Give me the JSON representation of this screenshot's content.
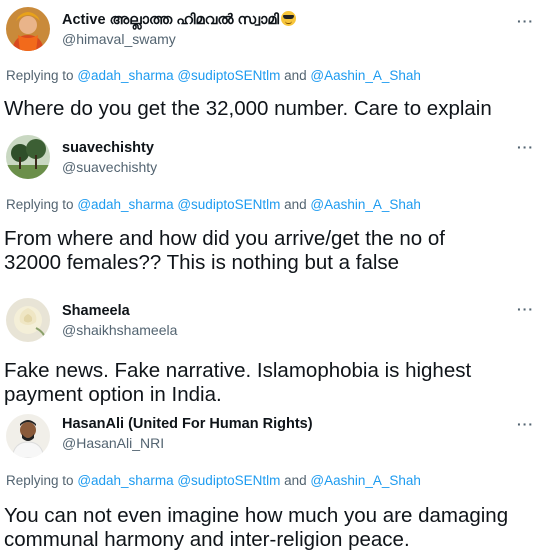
{
  "tweets": [
    {
      "name": "Active അല്ലാത്ത ഹിമവൽ സ്വാമി",
      "handle": "@himaval_swamy",
      "replying_prefix": "Replying to",
      "mentions": [
        "@adah_sharma",
        "@sudiptoSENtlm",
        "and",
        "@Aashin_A_Shah"
      ],
      "text": "Where do you get the 32,000 number. Care to explain",
      "more": "···",
      "emoji": "sunglasses-emoji"
    },
    {
      "name": "suavechishty",
      "handle": "@suavechishty",
      "replying_prefix": "Replying to",
      "mentions": [
        "@adah_sharma",
        "@sudiptoSENtlm",
        "and",
        "@Aashin_A_Shah"
      ],
      "text": "From where and how did you arrive/get the no of 32000 females?? This is nothing but a false",
      "more": "···"
    },
    {
      "name": "Shameela",
      "handle": "@shaikhshameela",
      "text": "Fake news. Fake narrative. Islamophobia is highest payment option in India.",
      "more": "···"
    },
    {
      "name": "HasanAli (United For Human Rights)",
      "handle": "@HasanAli_NRI",
      "replying_prefix": "Replying to",
      "mentions": [
        "@adah_sharma",
        "@sudiptoSENtlm",
        "and",
        "@Aashin_A_Shah"
      ],
      "text": "You can not even imagine how much you are damaging communal harmony and inter-religion peace.",
      "more": "···"
    }
  ],
  "colors": {
    "link": "#1d9bf0",
    "muted": "#536471",
    "text": "#0f1419"
  }
}
